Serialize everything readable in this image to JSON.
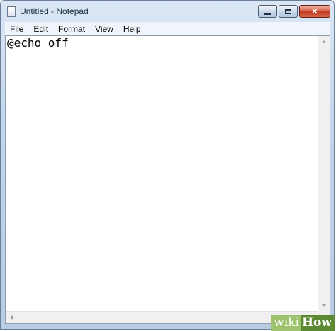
{
  "window": {
    "title": "Untitled - Notepad",
    "close_glyph": "✕"
  },
  "menu": {
    "items": [
      "File",
      "Edit",
      "Format",
      "View",
      "Help"
    ]
  },
  "editor": {
    "content": "@echo off"
  },
  "watermark": {
    "wiki": "wiki",
    "how": "How"
  },
  "icons": {
    "app": "notepad-icon",
    "minimize": "minimize-icon",
    "maximize": "maximize-icon",
    "close": "close-icon"
  },
  "colors": {
    "titlebar": "#c3d5ea",
    "close_button": "#c13a22",
    "editor_background": "#ffffff",
    "watermark_light": "#9ec36d",
    "watermark_dark": "#5c8a32"
  }
}
